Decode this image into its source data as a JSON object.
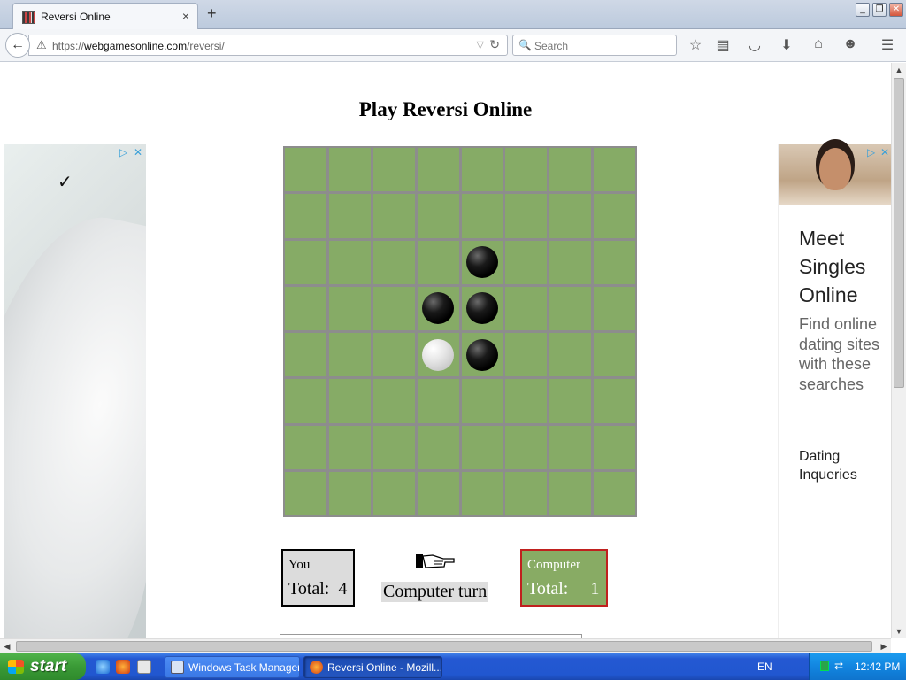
{
  "browser": {
    "tab_title": "Reversi Online",
    "tab_close": "×",
    "new_tab": "+",
    "url_prefix": "https://",
    "url_domain": "webgamesonline.com",
    "url_path": "/reversi/",
    "search_placeholder": "Search"
  },
  "page": {
    "title": "Play Reversi Online"
  },
  "board": {
    "size": 8,
    "discs": [
      {
        "row": 2,
        "col": 4,
        "color": "black"
      },
      {
        "row": 3,
        "col": 3,
        "color": "black"
      },
      {
        "row": 3,
        "col": 4,
        "color": "black"
      },
      {
        "row": 4,
        "col": 3,
        "color": "white"
      },
      {
        "row": 4,
        "col": 4,
        "color": "black"
      }
    ],
    "cell_color": "#86ab66"
  },
  "scores": {
    "you_label": "You",
    "you_total": "Total:  4",
    "computer_label": "Computer",
    "computer_total": "Total:     1",
    "turn_text": "Computer turn"
  },
  "ads": {
    "right_headline": "Meet Singles Online",
    "right_body": "Find online dating sites with these searches",
    "right_cta": "Dating Inqueries"
  },
  "taskbar": {
    "start_label": "start",
    "tasks": [
      {
        "label": "Windows Task Manager"
      },
      {
        "label": "Reversi Online - Mozill..."
      }
    ],
    "language": "EN",
    "clock": "12:42 PM"
  },
  "colors": {
    "board_green": "#86ab66",
    "computer_border": "#c0201e",
    "taskbar_blue": "#2157d0",
    "start_green": "#3a9a36"
  }
}
